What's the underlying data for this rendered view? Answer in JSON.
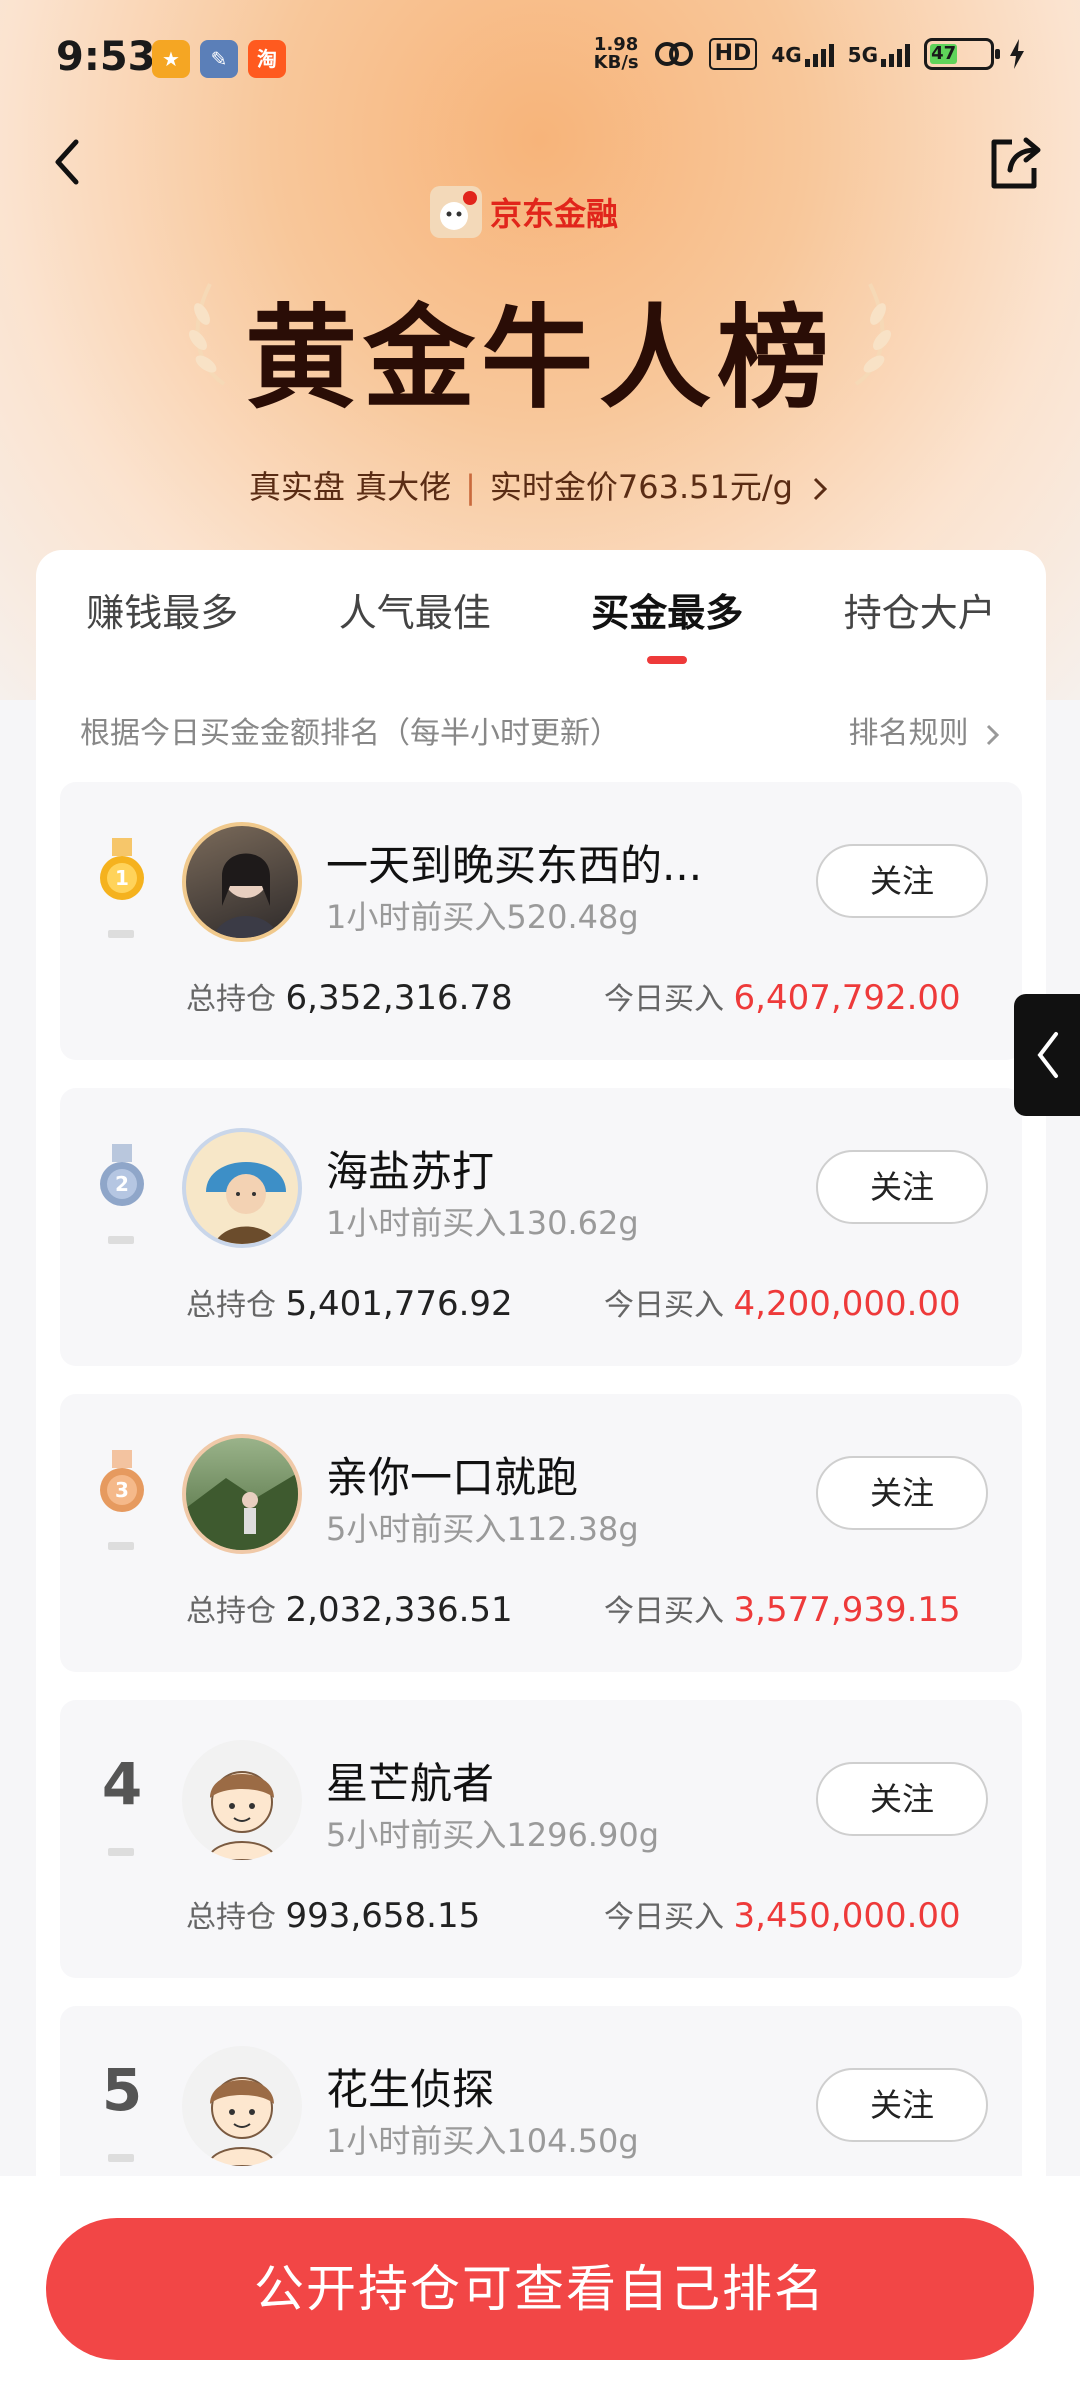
{
  "status_bar": {
    "time": "9:53",
    "net_speed_value": "1.98",
    "net_speed_unit": "KB/s",
    "hd_tag": "HD",
    "net1": "4G",
    "net2": "5G",
    "battery": "47"
  },
  "header": {
    "brand": "京东金融",
    "title": "黄金牛人榜",
    "tagline_left": "真实盘 真大佬",
    "tagline_right": "实时金价763.51元/g"
  },
  "tabs": [
    {
      "label": "赚钱最多",
      "active": false
    },
    {
      "label": "人气最佳",
      "active": false
    },
    {
      "label": "买金最多",
      "active": true
    },
    {
      "label": "持仓大户",
      "active": false
    }
  ],
  "rule": {
    "description": "根据今日买金金额排名（每半小时更新）",
    "link": "排名规则"
  },
  "follow_label": "关注",
  "holding_label": "总持仓",
  "today_label": "今日买入",
  "entries": [
    {
      "rank": "1",
      "name": "一天到晚买东西的...",
      "sub": "1小时前买入520.48g",
      "holding": "6,352,316.78",
      "today": "6,407,792.00"
    },
    {
      "rank": "2",
      "name": "海盐苏打",
      "sub": "1小时前买入130.62g",
      "holding": "5,401,776.92",
      "today": "4,200,000.00"
    },
    {
      "rank": "3",
      "name": "亲你一口就跑",
      "sub": "5小时前买入112.38g",
      "holding": "2,032,336.51",
      "today": "3,577,939.15"
    },
    {
      "rank": "4",
      "name": "星芒航者",
      "sub": "5小时前买入1296.90g",
      "holding": "993,658.15",
      "today": "3,450,000.00"
    },
    {
      "rank": "5",
      "name": "花生侦探",
      "sub": "1小时前买入104.50g"
    }
  ],
  "cta": "公开持仓可查看自己排名",
  "colors": {
    "accent": "#ee3a3a",
    "cta": "#f24646",
    "brand": "#e1251b"
  }
}
